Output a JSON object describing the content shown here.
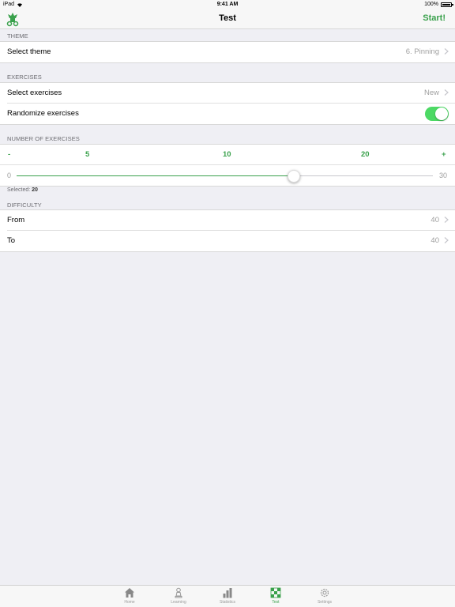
{
  "status_bar": {
    "device": "iPad",
    "time": "9:41 AM",
    "battery": "100%"
  },
  "nav": {
    "title": "Test",
    "start_label": "Start!"
  },
  "theme_section": {
    "header": "THEME",
    "select_theme": {
      "label": "Select theme",
      "value": "6. Pinning"
    }
  },
  "exercises_section": {
    "header": "EXERCISES",
    "select_exercises": {
      "label": "Select exercises",
      "value": "New"
    },
    "randomize": {
      "label": "Randomize exercises",
      "enabled": true
    }
  },
  "number_section": {
    "header": "NUMBER OF EXERCISES",
    "steps": {
      "minus": "-",
      "s1": "5",
      "s2": "10",
      "s3": "20",
      "plus": "+"
    },
    "slider": {
      "min": "0",
      "max": "30",
      "value": 20
    },
    "selected_label": "Selected:",
    "selected_value": "20"
  },
  "difficulty_section": {
    "header": "DIFFICULTY",
    "from": {
      "label": "From",
      "value": "40"
    },
    "to": {
      "label": "To",
      "value": "40"
    }
  },
  "tab_bar": {
    "tabs": [
      {
        "label": "Home",
        "icon": "home-icon"
      },
      {
        "label": "Learning",
        "icon": "pawn-icon"
      },
      {
        "label": "Statistics",
        "icon": "bar-chart-icon"
      },
      {
        "label": "Test",
        "icon": "checkerboard-icon",
        "active": true
      },
      {
        "label": "Settings",
        "icon": "gear-icon"
      }
    ]
  },
  "colors": {
    "accent": "#3aa14c",
    "toggle_on": "#4cd964",
    "background": "#efeff4"
  }
}
